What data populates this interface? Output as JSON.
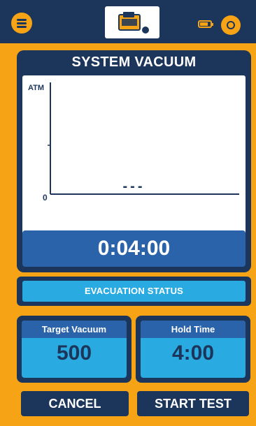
{
  "header": {
    "menu_icon": "menu-icon",
    "logo_icon": "brand-logo-icon",
    "battery_icon": "battery-icon",
    "power_icon": "power-icon"
  },
  "panel": {
    "title": "SYSTEM VACUUM",
    "timer": "0:04:00"
  },
  "chart": {
    "y_top_label": "ATM",
    "y_zero_label": "0",
    "units": "microns",
    "reading": "---",
    "bluetooth_icon": "bluetooth-icon"
  },
  "status": {
    "label": "EVACUATION STATUS"
  },
  "settings": {
    "target_label": "Target Vacuum",
    "target_value": "500",
    "hold_label": "Hold Time",
    "hold_value": "4:00"
  },
  "actions": {
    "cancel": "CANCEL",
    "start": "START TEST"
  },
  "colors": {
    "background": "#f6a316",
    "navy": "#1c355b",
    "blue": "#2a63a9",
    "light_blue": "#29aae1"
  }
}
